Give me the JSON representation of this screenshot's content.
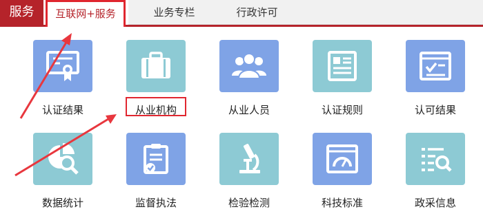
{
  "header": {
    "section_tag": "服务",
    "tabs": [
      {
        "label": "互联网+服务",
        "active": true
      },
      {
        "label": "业务专栏",
        "active": false
      },
      {
        "label": "行政许可",
        "active": false
      }
    ]
  },
  "tiles": [
    {
      "label": "认证结果",
      "icon": "certificate-icon",
      "color": "#7fa3e6"
    },
    {
      "label": "从业机构",
      "icon": "briefcase-icon",
      "color": "#8dcad4"
    },
    {
      "label": "从业人员",
      "icon": "people-group-icon",
      "color": "#7fa3e6"
    },
    {
      "label": "认证规则",
      "icon": "rules-document-icon",
      "color": "#8dcad4"
    },
    {
      "label": "认可结果",
      "icon": "approval-window-icon",
      "color": "#7fa3e6"
    },
    {
      "label": "数据统计",
      "icon": "chart-magnifier-icon",
      "color": "#8dcad4"
    },
    {
      "label": "监督执法",
      "icon": "clipboard-check-icon",
      "color": "#7fa3e6"
    },
    {
      "label": "检验检测",
      "icon": "microscope-icon",
      "color": "#8dcad4"
    },
    {
      "label": "科技标准",
      "icon": "gauge-window-icon",
      "color": "#7fa3e6"
    },
    {
      "label": "政采信息",
      "icon": "list-search-icon",
      "color": "#8dcad4"
    }
  ],
  "colors": {
    "accent": "#b5232a",
    "annotation": "#e0262f"
  }
}
